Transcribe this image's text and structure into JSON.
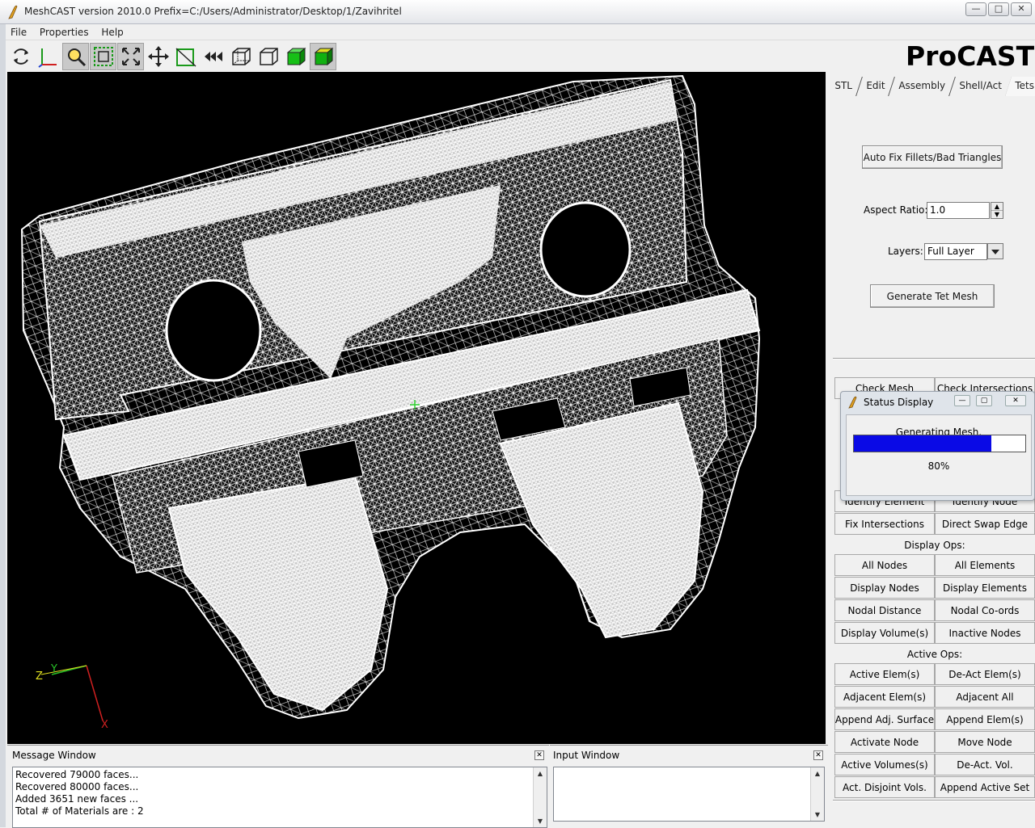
{
  "window": {
    "title": "MeshCAST version 2010.0   Prefix=C:/Users/Administrator/Desktop/1/Zavihritel",
    "controls": [
      "—",
      "□",
      "✕"
    ]
  },
  "menu": [
    "File",
    "Properties",
    "Help"
  ],
  "toolbar": {
    "icons": [
      "rotate-icon",
      "axes-icon",
      "zoom-icon",
      "zoom-box-icon",
      "fit-icon",
      "pan-icon",
      "clip-icon",
      "reset-view-icon",
      "box-outline-icon",
      "box-icon",
      "shaded-box-icon",
      "shaded-color-box-icon"
    ]
  },
  "brand": "ProCAST",
  "tabs": [
    "STL",
    "Edit",
    "Assembly",
    "Shell/Act",
    "Tets"
  ],
  "active_tab": "Tets",
  "tets": {
    "auto_fix_label": "Auto Fix Fillets/Bad Triangles",
    "aspect_ratio_label": "Aspect Ratio:",
    "aspect_ratio_value": "1.0",
    "layers_label": "Layers:",
    "layers_value": "Full Layer",
    "generate_label": "Generate Tet Mesh"
  },
  "mesh_ops": {
    "row1": [
      "Check Mesh",
      "Check Intersections"
    ],
    "row_hidden": [
      "Identify Element",
      "Identify Node"
    ],
    "row2": [
      "Fix Intersections",
      "Direct Swap Edge"
    ]
  },
  "display_ops": {
    "label": "Display Ops:",
    "buttons": [
      "All Nodes",
      "All Elements",
      "Display Nodes",
      "Display Elements",
      "Nodal Distance",
      "Nodal Co-ords",
      "Display Volume(s)",
      "Inactive Nodes"
    ]
  },
  "active_ops": {
    "label": "Active Ops:",
    "buttons": [
      "Active Elem(s)",
      "De-Act Elem(s)",
      "Adjacent Elem(s)",
      "Adjacent All",
      "Append Adj. Surface",
      "Append Elem(s)",
      "Activate Node",
      "Move Node",
      "Active Volumes(s)",
      "De-Act. Vol.",
      "Act. Disjoint Vols.",
      "Append Active Set"
    ]
  },
  "status_display": {
    "title": "Status Display",
    "message": "Generating Mesh.",
    "progress": 0.8,
    "progress_text": "80%",
    "bar_color": "#0a0ae6"
  },
  "axes": {
    "z": "Z",
    "y": "Y",
    "x": "X"
  },
  "message_window": {
    "title": "Message Window",
    "lines": [
      "Recovered 79000 faces...",
      "Recovered 80000 faces...",
      "Added 3651 new faces ...",
      "Total # of Materials are : 2"
    ]
  },
  "input_window": {
    "title": "Input Window"
  }
}
